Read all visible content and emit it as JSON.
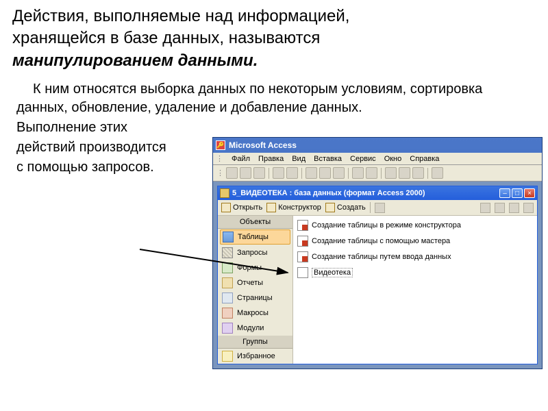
{
  "heading": {
    "line1": "Действия, выполняемые над информацией,",
    "line2": "хранящейся в базе данных, называются",
    "emph": "манипулированием данными."
  },
  "body": {
    "p1": "К ним относятся выборка данных по некоторым условиям, сортировка данных, обновление, удаление и добавление данных.",
    "p2a": "Выполнение этих",
    "p2b": "действий производится",
    "p2c": "с помощью запросов."
  },
  "access": {
    "app_title": "Microsoft Access",
    "menu": {
      "file": "Файл",
      "edit": "Правка",
      "view": "Вид",
      "insert": "Вставка",
      "tools": "Сервис",
      "window": "Окно",
      "help": "Справка"
    },
    "db_title": "5_ВИДЕОТЕКА : база данных (формат Access 2000)",
    "db_toolbar": {
      "open": "Открыть",
      "design": "Конструктор",
      "create": "Создать"
    },
    "nav": {
      "objects_header": "Объекты",
      "groups_header": "Группы",
      "tables": "Таблицы",
      "queries": "Запросы",
      "forms": "Формы",
      "reports": "Отчеты",
      "pages": "Страницы",
      "macros": "Макросы",
      "modules": "Модули",
      "favorites": "Избранное"
    },
    "list": {
      "item1": "Создание таблицы в режиме конструктора",
      "item2": "Создание таблицы с помощью мастера",
      "item3": "Создание таблицы путем ввода данных",
      "item4": "Видеотека"
    },
    "winbtns": {
      "min": "–",
      "max": "□",
      "close": "×"
    }
  }
}
